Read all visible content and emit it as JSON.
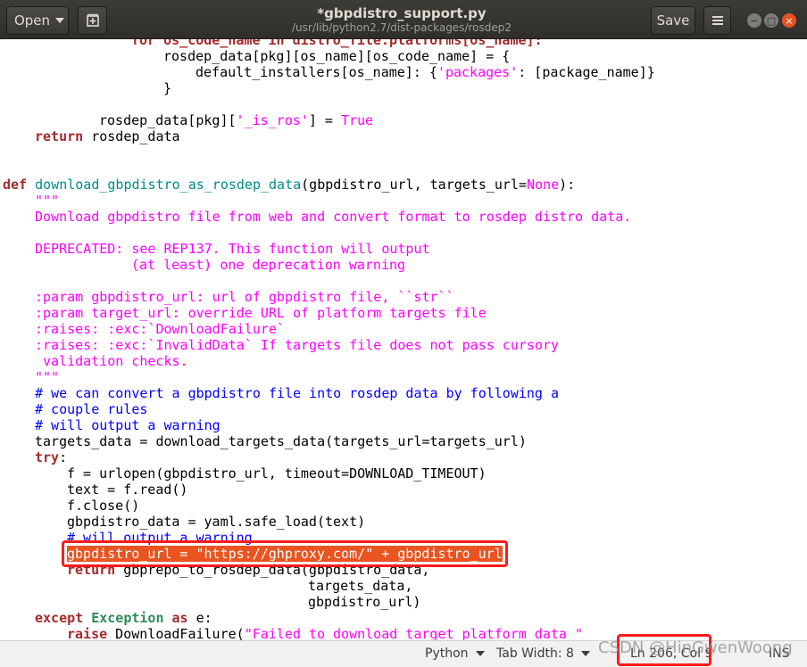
{
  "window": {
    "title": "*gbpdistro_support.py",
    "subtitle": "/usr/lib/python2.7/dist-packages/rosdep2"
  },
  "toolbar": {
    "open_label": "Open",
    "new_document_icon": "new-document-icon",
    "save_label": "Save",
    "menu_icon": "hamburger-menu-icon"
  },
  "window_controls": {
    "minimize_glyph": "−",
    "maximize_glyph": "□",
    "close_glyph": "×",
    "close_color": "#e95420"
  },
  "code": {
    "l01": "for os_code_name in distro_file.platforms[os_name]:",
    "l02": "rosdep_data[pkg][os_name][os_code_name] = {",
    "l03a": "default_installers[os_name]: {",
    "l03b": "'packages'",
    "l03c": ": [package_name]}",
    "l04": "}",
    "l05a": "rosdep_data[pkg][",
    "l05b": "'_is_ros'",
    "l05c": "] = ",
    "l05d": "True",
    "l06a": "return",
    "l06b": " rosdep_data",
    "l07a": "def",
    "l07b": "download_gbpdistro_as_rosdep_data",
    "l07c": "(gbpdistro_url, targets_url=",
    "l07d": "None",
    "l07e": "):",
    "l08": "\"\"\"",
    "l09": "Download gbpdistro file from web and convert format to rosdep distro data.",
    "l10": "DEPRECATED: see REP137. This function will output",
    "l11": "(at least) one deprecation warning",
    "l12": ":param gbpdistro_url: url of gbpdistro file, ``str``",
    "l13": ":param target_url: override URL of platform targets file",
    "l14": ":raises: :exc:`DownloadFailure`",
    "l15": ":raises: :exc:`InvalidData` If targets file does not pass cursory",
    "l16": "validation checks.",
    "l17": "\"\"\"",
    "l18": "# we can convert a gbpdistro file into rosdep data by following a",
    "l19": "# couple rules",
    "l20": "# will output a warning",
    "l21": "targets_data = download_targets_data(targets_url=targets_url)",
    "l22a": "try",
    "l22b": ":",
    "l23": "f = urlopen(gbpdistro_url, timeout=DOWNLOAD_TIMEOUT)",
    "l24": "text = f.read()",
    "l25": "f.close()",
    "l26": "gbpdistro_data = yaml.safe_load(text)",
    "l27": "# will output a warning",
    "l28": "gbpdistro_url = \"https://ghproxy.com/\" + gbpdistro_url",
    "l29a": "return",
    "l29b": " gbprepo_to_rosdep_data(gbpdistro_data,",
    "l30": "targets_data,",
    "l31": "gbpdistro_url)",
    "l32a": "except",
    "l32b": "Exception",
    "l32c": "as",
    "l32d": " e:",
    "l33a": "raise",
    "l33b": " DownloadFailure(",
    "l33c": "\"Failed to download target platform data \""
  },
  "statusbar": {
    "language": "Python",
    "tab_width": "Tab Width: 8",
    "position": "Ln 206, Col 9",
    "mode": "INS"
  },
  "watermark": "CSDN @HinGwenWoong",
  "colors": {
    "keyword": "#a52a2a",
    "function_name": "#008a8c",
    "string": "#ff00ff",
    "comment": "#0000ff",
    "selection": "#e95420",
    "annotation_box": "#ff1a1a"
  }
}
